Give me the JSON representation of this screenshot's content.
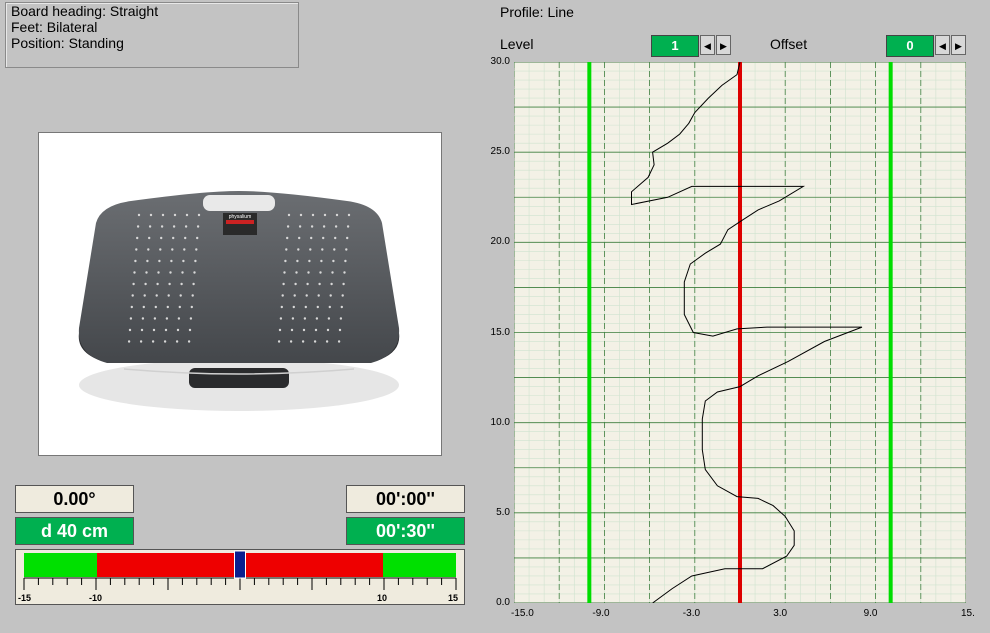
{
  "info": {
    "board_heading": "Board heading: Straight",
    "feet": "Feet: Bilateral",
    "position": "Position: Standing"
  },
  "board_product": {
    "brand": "physalium"
  },
  "readouts": {
    "angle": "0.00°",
    "distance": "d 40 cm",
    "time_elapsed": "00':00''",
    "time_total": "00':30''"
  },
  "scale": {
    "labels": [
      "-15",
      "-10",
      "10",
      "15"
    ],
    "indicator_value": 0,
    "colors": {
      "green": "#00e000",
      "red": "#ee0000",
      "indicator": "#0a1f8f"
    }
  },
  "profile": {
    "title": "Profile: Line"
  },
  "level": {
    "label": "Level",
    "value": "1"
  },
  "offset": {
    "label": "Offset",
    "value": "0"
  },
  "chart_data": {
    "type": "line",
    "xlim": [
      -15,
      15
    ],
    "ylim": [
      0,
      30
    ],
    "x_ticks": [
      "-15.0",
      "-9.0",
      "-3.0",
      "3.0",
      "9.0",
      "15."
    ],
    "y_ticks": [
      "0.0",
      "5.0",
      "10.0",
      "15.0",
      "20.0",
      "25.0",
      "30.0"
    ],
    "grid": true,
    "reference_lines": [
      {
        "x": -10,
        "color": "#00dd00"
      },
      {
        "x": 0,
        "color": "#dd0000"
      },
      {
        "x": 10,
        "color": "#00dd00"
      }
    ],
    "series": [
      {
        "points": [
          [
            -5.8,
            0
          ],
          [
            -4.5,
            0.8
          ],
          [
            -3.2,
            1.5
          ],
          [
            -1,
            1.9
          ],
          [
            1.5,
            1.9
          ],
          [
            3.1,
            2.6
          ],
          [
            3.6,
            3.2
          ],
          [
            3.6,
            4.0
          ],
          [
            3.0,
            4.8
          ],
          [
            2.2,
            5.4
          ],
          [
            1.2,
            5.8
          ],
          [
            -0.2,
            5.9
          ],
          [
            -1.5,
            6.5
          ],
          [
            -2.3,
            7.4
          ],
          [
            -2.5,
            8.5
          ],
          [
            -2.5,
            10.2
          ],
          [
            -2.3,
            11.2
          ],
          [
            -1.5,
            11.7
          ],
          [
            0,
            12.0
          ],
          [
            1.2,
            12.6
          ],
          [
            3.2,
            13.4
          ],
          [
            5.6,
            14.5
          ],
          [
            8.1,
            15.3
          ],
          [
            1.8,
            15.3
          ],
          [
            -0.2,
            15.2
          ],
          [
            -1.8,
            14.8
          ],
          [
            -3.1,
            15.0
          ],
          [
            -3.7,
            16.0
          ],
          [
            -3.7,
            17.8
          ],
          [
            -3.3,
            18.8
          ],
          [
            -2.3,
            19.4
          ],
          [
            -1.3,
            19.9
          ],
          [
            -0.8,
            20.7
          ],
          [
            0.1,
            21.2
          ],
          [
            1.2,
            21.8
          ],
          [
            2.6,
            22.3
          ],
          [
            4.2,
            23.1
          ],
          [
            -0.1,
            23.1
          ],
          [
            -3.2,
            23.1
          ],
          [
            -4.8,
            22.5
          ],
          [
            -7.2,
            22.1
          ],
          [
            -7.2,
            22.8
          ],
          [
            -6.1,
            23.6
          ],
          [
            -5.7,
            24.3
          ],
          [
            -5.8,
            25.0
          ],
          [
            -4.8,
            25.5
          ],
          [
            -4.0,
            26.0
          ],
          [
            -3.4,
            26.6
          ],
          [
            -3.0,
            27.2
          ],
          [
            -2.1,
            28.0
          ],
          [
            -1.2,
            28.7
          ],
          [
            -0.2,
            29.3
          ],
          [
            0,
            30
          ]
        ]
      }
    ]
  }
}
